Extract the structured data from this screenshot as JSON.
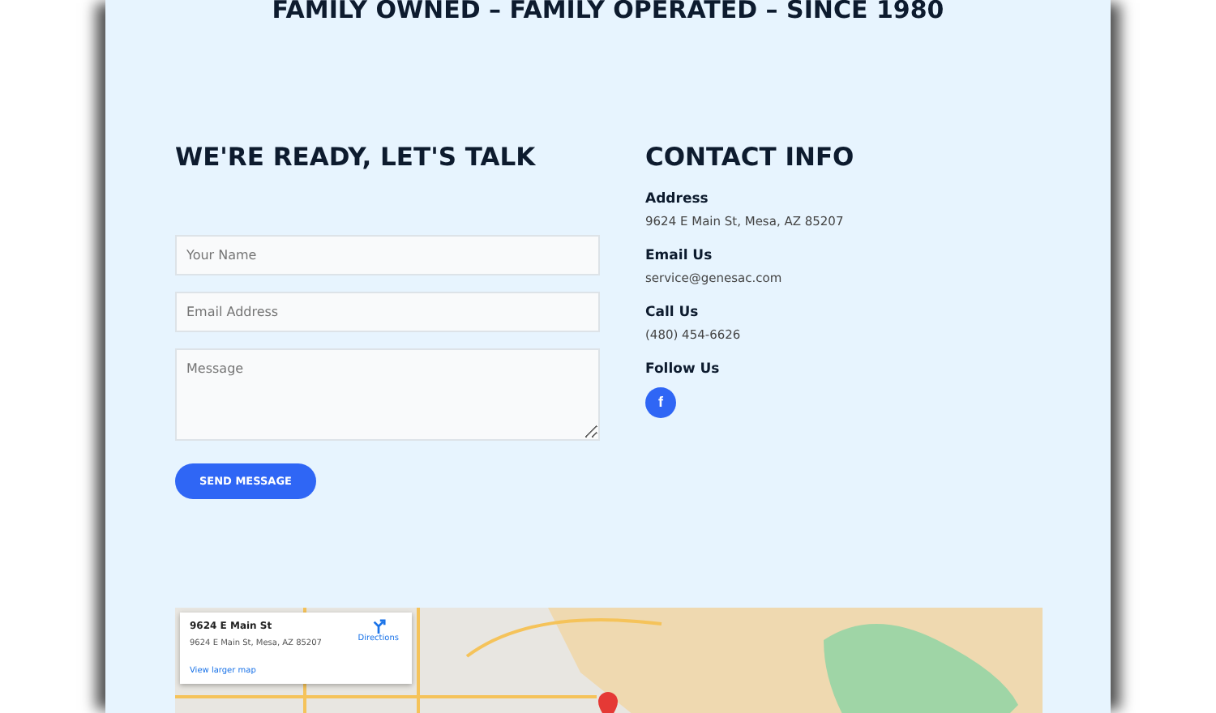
{
  "tagline": "FAMILY OWNED – FAMILY OPERATED – SINCE 1980",
  "form": {
    "heading": "WE'RE READY, LET'S TALK",
    "fields": [
      {
        "kind": "input",
        "placeholder": "Your Name"
      },
      {
        "kind": "input",
        "placeholder": "Email Address"
      },
      {
        "kind": "textarea",
        "placeholder": "Message"
      }
    ],
    "button": "SEND MESSAGE"
  },
  "contact": {
    "heading": "CONTACT INFO",
    "items": [
      {
        "label": "Address",
        "value": "9624 E Main St, Mesa, AZ 85207"
      },
      {
        "label": "Email Us",
        "value": "service@genesac.com"
      },
      {
        "label": "Call Us",
        "value": "(480) 454-6626"
      }
    ],
    "follow": "Follow Us",
    "social": [
      {
        "glyph": "f"
      }
    ]
  },
  "map": {
    "card": {
      "title": "9624 E Main St",
      "address": "9624 E Main St, Mesa, AZ 85207",
      "directions": "Directions",
      "larger": "View larger map"
    }
  }
}
